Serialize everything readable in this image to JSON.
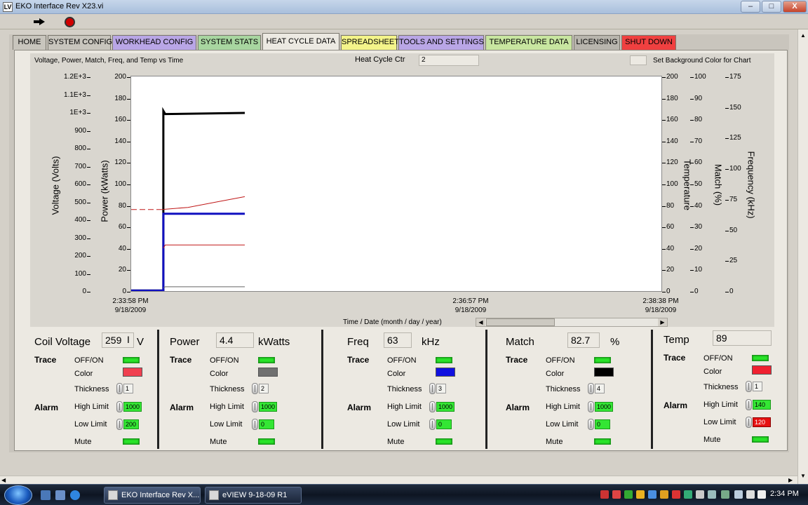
{
  "window": {
    "title": "EKO Interface Rev X23.vi",
    "app_icon": "LV",
    "minimize": "–",
    "maximize": "□",
    "close": "X"
  },
  "tabs": [
    {
      "label": "HOME",
      "color": "#c8c5bd"
    },
    {
      "label": "SYSTEM CONFIG",
      "color": "#c8c5bd"
    },
    {
      "label": "WORKHEAD CONFIG",
      "color": "#b9a6e6"
    },
    {
      "label": "SYSTEM STATS",
      "color": "#a8d6a0"
    },
    {
      "label": "HEAT CYCLE DATA",
      "color": "#ece9e2"
    },
    {
      "label": "SPREADSHEET",
      "color": "#f4f48a"
    },
    {
      "label": "TOOLS AND SETTINGS",
      "color": "#b9a6e6"
    },
    {
      "label": "TEMPERATURE DATA",
      "color": "#c8e6a0"
    },
    {
      "label": "LICENSING",
      "color": "#b8b5ad"
    },
    {
      "label": "SHUT DOWN",
      "color": "#f04040"
    }
  ],
  "chart_panel": {
    "title": "Voltage, Power, Match, Freq, and Temp vs Time",
    "cycle_label": "Heat Cycle Ctr",
    "cycle_value": "2",
    "bg_color_label": "Set Background Color for Chart",
    "time_axis_label": "Time / Date (month / day / year)"
  },
  "chart_data": {
    "type": "line",
    "x_ticks": [
      {
        "time": "2:33:58 PM",
        "date": "9/18/2009"
      },
      {
        "time": "2:36:57 PM",
        "date": "9/18/2009"
      },
      {
        "time": "2:38:38 PM",
        "date": "9/18/2009"
      }
    ],
    "axes": {
      "voltage": {
        "label": "Voltage (Volts)",
        "ticks": [
          "1.2E+3",
          "1.1E+3",
          "1E+3",
          "900",
          "800",
          "700",
          "600",
          "500",
          "400",
          "300",
          "200",
          "100",
          "0"
        ],
        "range": [
          0,
          1200
        ]
      },
      "power": {
        "label": "Power (kWatts)",
        "ticks": [
          "200",
          "180",
          "160",
          "140",
          "120",
          "100",
          "80",
          "60",
          "40",
          "20",
          "0"
        ],
        "range": [
          0,
          200
        ]
      },
      "temperature": {
        "label": "Temperature",
        "ticks": [
          "200",
          "180",
          "160",
          "140",
          "120",
          "100",
          "80",
          "60",
          "40",
          "20",
          "0"
        ],
        "range": [
          0,
          200
        ]
      },
      "match": {
        "label": "Match (%)",
        "ticks": [
          "100",
          "90",
          "80",
          "70",
          "60",
          "50",
          "40",
          "30",
          "20",
          "10",
          "0"
        ],
        "range": [
          0,
          100
        ]
      },
      "frequency": {
        "label": "Frequency (kHz)",
        "ticks": [
          "175",
          "150",
          "125",
          "100",
          "75",
          "50",
          "25",
          "0"
        ],
        "range": [
          0,
          175
        ]
      }
    },
    "x_range_seconds": [
      0,
      280
    ],
    "series": [
      {
        "color": "#000000",
        "axis": "power",
        "points": [
          [
            0,
            0.5
          ],
          [
            17,
            0.5
          ],
          [
            17,
            168
          ],
          [
            18,
            165
          ],
          [
            60,
            166
          ]
        ]
      },
      {
        "color": "#1010c0",
        "axis": "power",
        "points": [
          [
            0,
            0.5
          ],
          [
            17,
            0.5
          ],
          [
            17,
            72
          ],
          [
            60,
            72
          ]
        ]
      },
      {
        "color": "#c01818",
        "axis": "power",
        "points": [
          [
            17,
            40
          ],
          [
            18,
            43
          ],
          [
            60,
            43
          ]
        ]
      },
      {
        "color": "#c01818",
        "axis": "temperature",
        "dashed": true,
        "points": [
          [
            0,
            76
          ],
          [
            16,
            76
          ]
        ]
      },
      {
        "color": "#c01818",
        "axis": "temperature",
        "points": [
          [
            16,
            76
          ],
          [
            30,
            78
          ],
          [
            45,
            83
          ],
          [
            60,
            88
          ]
        ]
      },
      {
        "color": "#666666",
        "axis": "power",
        "points": [
          [
            17,
            3
          ],
          [
            18,
            4
          ],
          [
            60,
            4
          ]
        ]
      }
    ]
  },
  "controls": [
    {
      "name": "Coil Voltage",
      "value": "259",
      "unit": "V",
      "color": "#f04050",
      "thickness": "1",
      "high": "1000",
      "low": "200",
      "high_red": false,
      "low_red": false
    },
    {
      "name": "Power",
      "value": "4.4",
      "unit": "kWatts",
      "color": "#707070",
      "thickness": "2",
      "high": "1000",
      "low": "0",
      "high_red": false,
      "low_red": false
    },
    {
      "name": "Freq",
      "value": "63",
      "unit": "kHz",
      "color": "#1010e0",
      "thickness": "3",
      "high": "1000",
      "low": "0",
      "high_red": false,
      "low_red": false
    },
    {
      "name": "Match",
      "value": "82.7",
      "unit": "%",
      "color": "#000000",
      "thickness": "4",
      "high": "1000",
      "low": "0",
      "high_red": false,
      "low_red": false
    },
    {
      "name": "Temp",
      "value": "89",
      "unit": "",
      "color": "#f02030",
      "thickness": "1",
      "high": "140",
      "low": "120",
      "high_red": false,
      "low_red": true
    }
  ],
  "control_labels": {
    "trace": "Trace",
    "offon": "OFF/ON",
    "color": "Color",
    "thickness": "Thickness",
    "alarm": "Alarm",
    "high": "High Limit",
    "low": "Low Limit",
    "mute": "Mute"
  },
  "taskbar": {
    "tasks": [
      "EKO Interface Rev X...",
      "eVIEW 9-18-09 R1"
    ],
    "clock": "2:34 PM"
  }
}
